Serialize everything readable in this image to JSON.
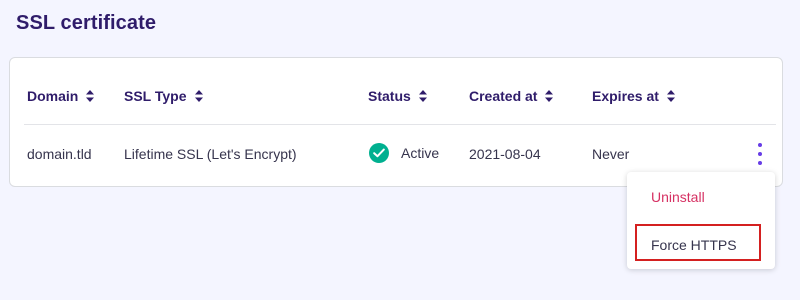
{
  "page": {
    "title": "SSL certificate"
  },
  "table": {
    "columns": [
      {
        "label": "Domain"
      },
      {
        "label": "SSL Type"
      },
      {
        "label": "Status"
      },
      {
        "label": "Created at"
      },
      {
        "label": "Expires at"
      }
    ],
    "rows": [
      {
        "domain": "domain.tld",
        "ssl_type": "Lifetime SSL (Let's Encrypt)",
        "status": "Active",
        "created_at": "2021-08-04",
        "expires_at": "Never"
      }
    ]
  },
  "row_menu": {
    "items": [
      {
        "label": "Uninstall",
        "color": "#d63163"
      },
      {
        "label": "Force HTTPS",
        "highlighted": true
      }
    ]
  },
  "colors": {
    "title": "#2f1c6a",
    "accent": "#673de6",
    "status_active": "#00b090",
    "danger": "#d63163",
    "highlight": "#d42020"
  },
  "icons": {
    "sort": "sort-icon",
    "status": "check-circle-icon",
    "row_actions": "more-vertical-icon"
  }
}
